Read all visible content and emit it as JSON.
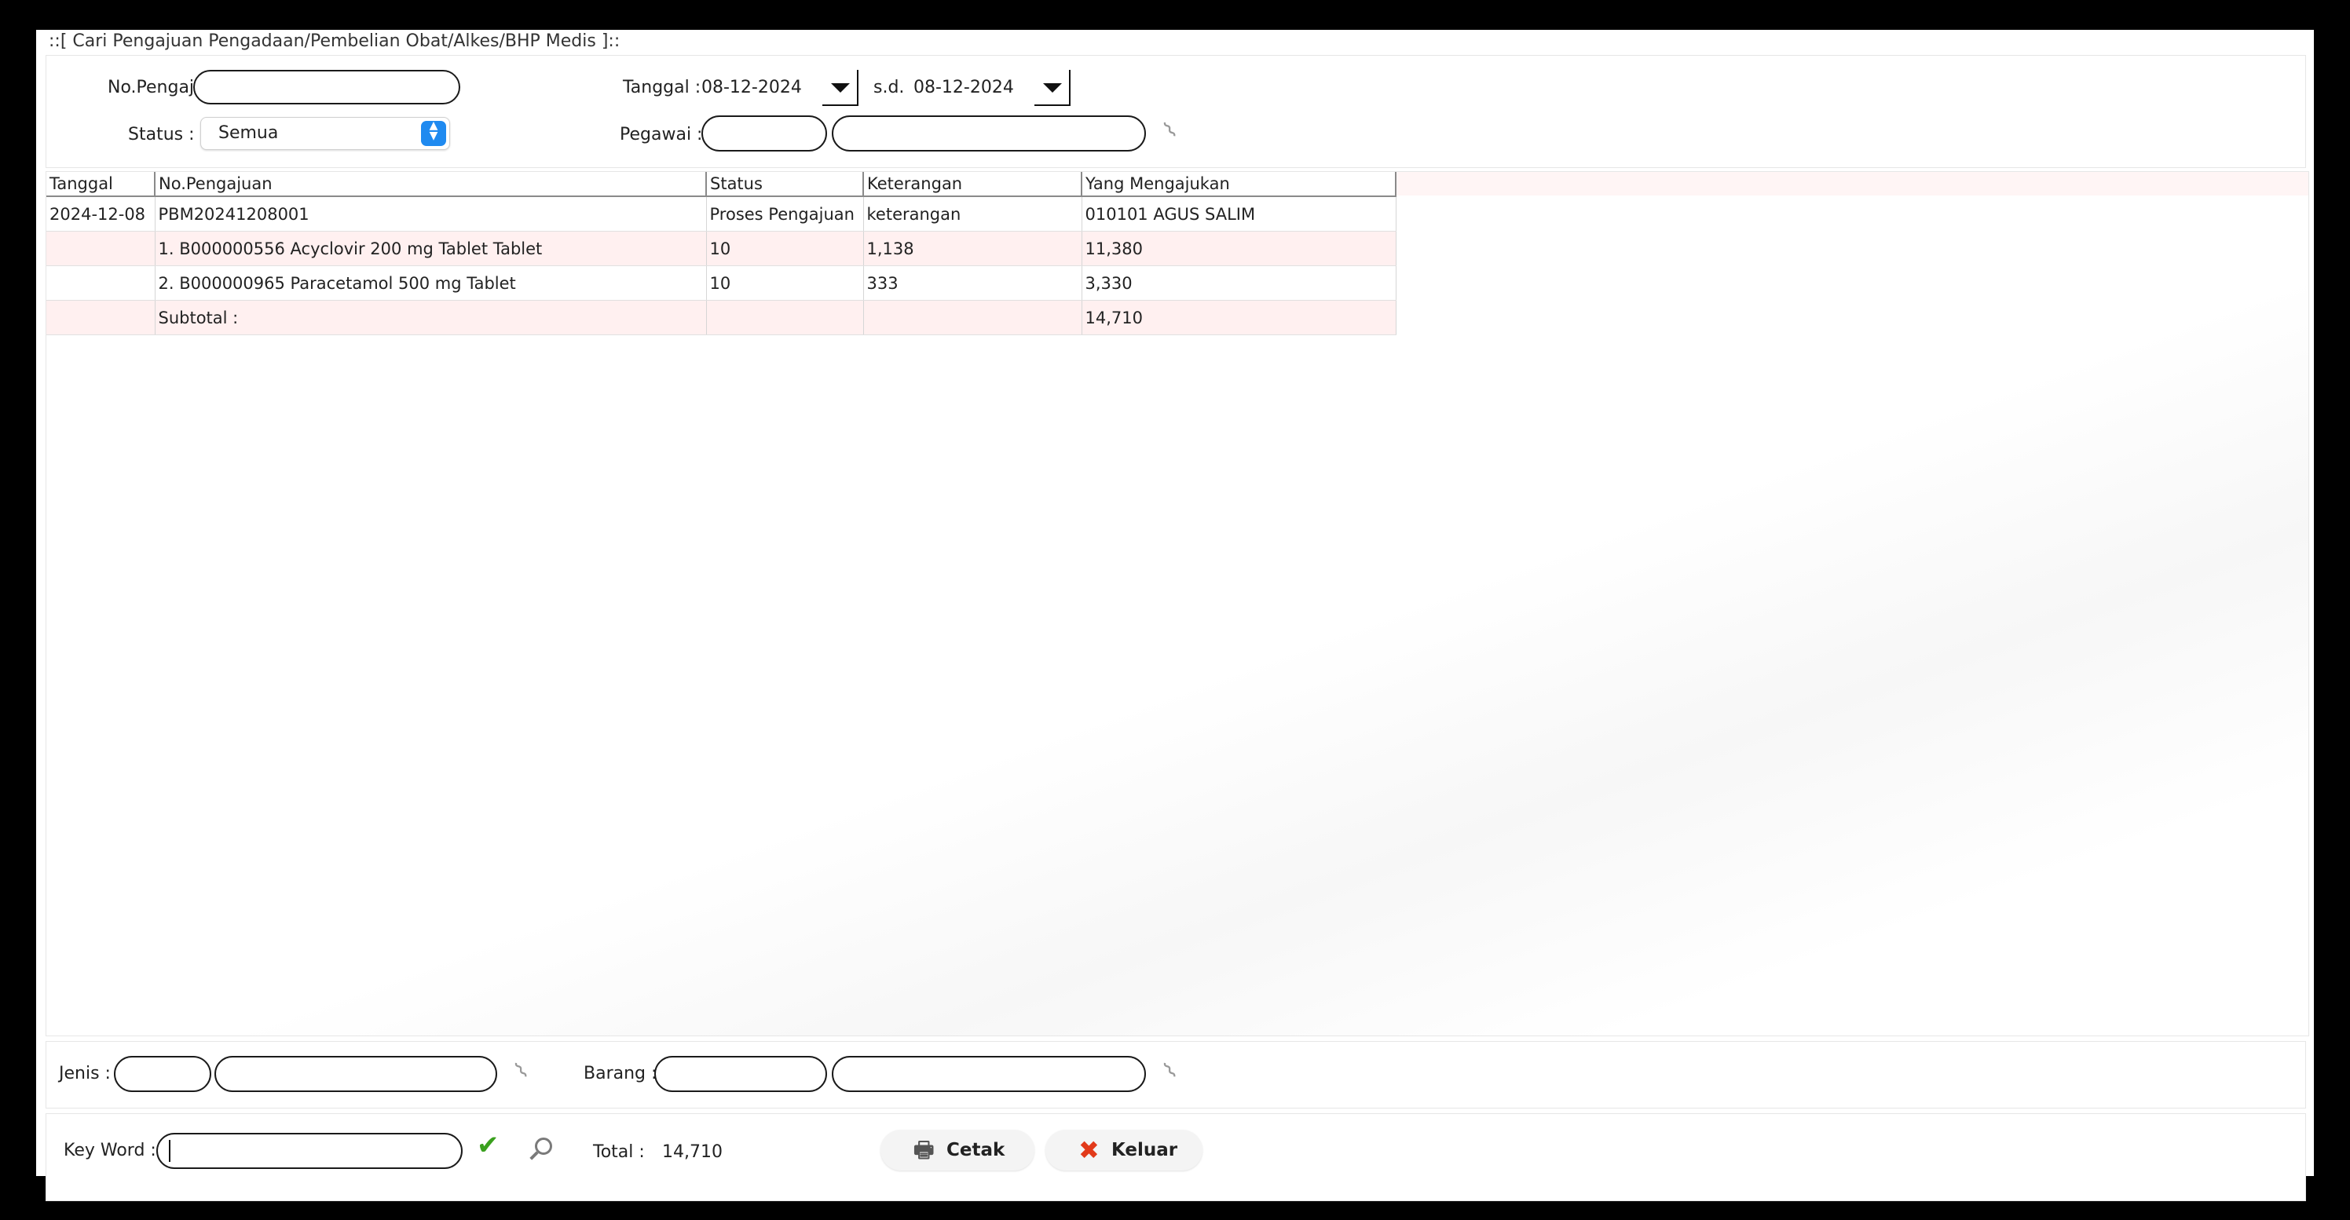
{
  "window": {
    "title": "::[ Cari Pengajuan Pengadaan/Pembelian Obat/Alkes/BHP Medis ]::"
  },
  "filters": {
    "no_pengajuan_label": "No.Pengajuan :",
    "no_pengajuan_value": "",
    "tanggal_label": "Tanggal :",
    "tanggal_from": "08-12-2024",
    "sd_label": "s.d.",
    "tanggal_to": "08-12-2024",
    "status_label": "Status :",
    "status_value": "Semua",
    "pegawai_label": "Pegawai :",
    "pegawai_code": "",
    "pegawai_name": ""
  },
  "table": {
    "columns": [
      "Tanggal",
      "No.Pengajuan",
      "Status",
      "Keterangan",
      "Yang Mengajukan"
    ],
    "rows": [
      [
        "2024-12-08",
        "PBM20241208001",
        "Proses Pengajuan",
        "keterangan",
        "010101 AGUS SALIM"
      ],
      [
        "",
        "1. B000000556 Acyclovir 200 mg Tablet Tablet",
        "10",
        "1,138",
        "11,380"
      ],
      [
        "",
        "2. B000000965 Paracetamol 500 mg Tablet",
        "10",
        "333",
        "3,330"
      ],
      [
        "",
        "Subtotal :",
        "",
        "",
        "14,710"
      ]
    ]
  },
  "bottom_filters": {
    "jenis_label": "Jenis :",
    "jenis_code": "",
    "jenis_name": "",
    "barang_label": "Barang :",
    "barang_code": "",
    "barang_name": ""
  },
  "footer": {
    "keyword_label": "Key Word :",
    "keyword_value": "",
    "total_label": "Total :",
    "total_value": "14,710",
    "cetak_label": "Cetak",
    "keluar_label": "Keluar"
  },
  "icons": {
    "date_dropdown": "triangle-down-icon",
    "status_select": "updown-arrows-icon",
    "lookup": "paperclip-icon",
    "confirm": "checkmark-icon",
    "search": "magnifier-icon",
    "print": "printer-icon",
    "exit": "red-x-icon"
  },
  "colors": {
    "row_alt": "#fff0f0",
    "select_accent": "#1f8af0",
    "check_green": "#3aa01e",
    "exit_red": "#e23a1a"
  }
}
